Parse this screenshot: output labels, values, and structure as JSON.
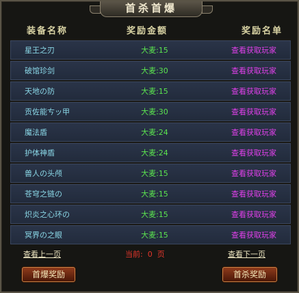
{
  "title": "首杀首爆",
  "headers": {
    "name": "装备名称",
    "reward": "奖励金额",
    "list": "奖励名单"
  },
  "rows": [
    {
      "name": "星王之刃",
      "reward": "大麦:15",
      "action": "查看获取玩家"
    },
    {
      "name": "破馆珍剑",
      "reward": "大麦:30",
      "action": "查看获取玩家"
    },
    {
      "name": "天地の防",
      "reward": "大麦:15",
      "action": "查看获取玩家"
    },
    {
      "name": "贡佐能ㄘッ甲",
      "reward": "大麦:30",
      "action": "查看获取玩家"
    },
    {
      "name": "魔法盾",
      "reward": "大麦:24",
      "action": "查看获取玩家"
    },
    {
      "name": "护体神盾",
      "reward": "大麦:24",
      "action": "查看获取玩家"
    },
    {
      "name": "兽人の头颅",
      "reward": "大麦:15",
      "action": "查看获取玩家"
    },
    {
      "name": "苍穹之链の",
      "reward": "大麦:15",
      "action": "查看获取玩家"
    },
    {
      "name": "炽炎之心环の",
      "reward": "大麦:15",
      "action": "查看获取玩家"
    },
    {
      "name": "冥界の之眼",
      "reward": "大麦:15",
      "action": "查看获取玩家"
    }
  ],
  "pagination": {
    "prev": "查看上一页",
    "current": "当前:  0  页",
    "next": "查看下一页"
  },
  "buttons": {
    "first_drop": "首爆奖励",
    "first_kill": "首杀奖励"
  }
}
